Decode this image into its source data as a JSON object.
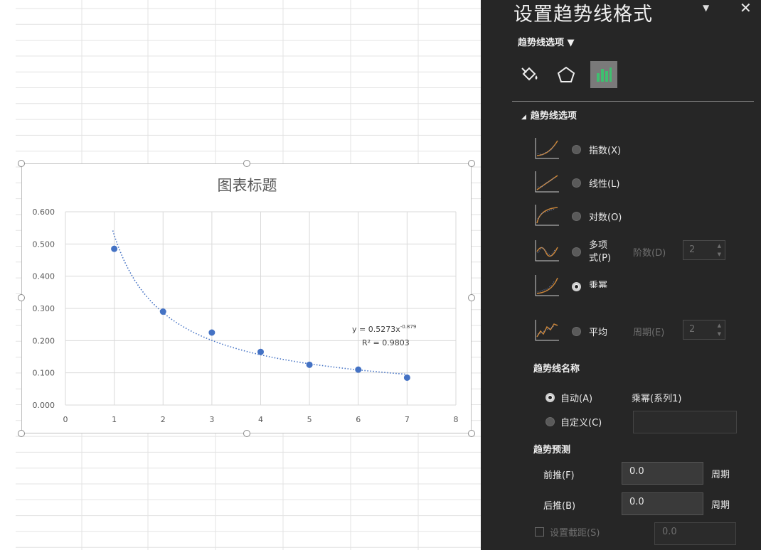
{
  "chart": {
    "title": "图表标题",
    "equation": "y = 0.5273x",
    "equation_exponent": "-0.879",
    "r_squared": "R² = 0.9803"
  },
  "chart_data": {
    "type": "scatter",
    "title": "图表标题",
    "xlabel": "",
    "ylabel": "",
    "xlim": [
      0,
      8
    ],
    "ylim": [
      0,
      0.6
    ],
    "x_ticks": [
      "0",
      "1",
      "2",
      "3",
      "4",
      "5",
      "6",
      "7",
      "8"
    ],
    "y_ticks": [
      "0.000",
      "0.100",
      "0.200",
      "0.300",
      "0.400",
      "0.500",
      "0.600"
    ],
    "grid": true,
    "series": [
      {
        "x": [
          1,
          2,
          3,
          4,
          5,
          6,
          7
        ],
        "y": [
          0.485,
          0.29,
          0.225,
          0.165,
          0.125,
          0.11,
          0.085
        ]
      }
    ],
    "trendline": {
      "type": "power",
      "coefficient": 0.5273,
      "exponent": -0.879,
      "r_squared": 0.9803,
      "style": "dotted"
    },
    "marker_color": "#4472c4",
    "trendline_color": "#4472c4"
  },
  "pane": {
    "title": "设置趋势线格式",
    "options_menu": "趋势线选项 ▼",
    "section_header": "趋势线选项",
    "trend_types": {
      "exponential": "指数(X)",
      "linear": "线性(L)",
      "logarithmic": "对数(O)",
      "polynomial_1": "多项",
      "polynomial_2": "式(P)",
      "power": "乘幂",
      "moving_average": "平均"
    },
    "order_label": "阶数(D)",
    "order_value": "2",
    "period_label": "周期(E)",
    "period_value": "2",
    "name_header": "趋势线名称",
    "automatic_label": "自动(A)",
    "automatic_value": "乘幂(系列1)",
    "custom_label": "自定义(C)",
    "forecast_header": "趋势预测",
    "forward_label": "前推(F)",
    "forward_value": "0.0",
    "backward_label": "后推(B)",
    "backward_value": "0.0",
    "period_unit": "周期",
    "intercept_label": "设置截距(S)",
    "intercept_value": "0.0"
  },
  "icons": [
    "fill-line-icon",
    "effects-pentagon-icon",
    "trendline-options-icon",
    "close-icon",
    "dropdown-icon"
  ]
}
